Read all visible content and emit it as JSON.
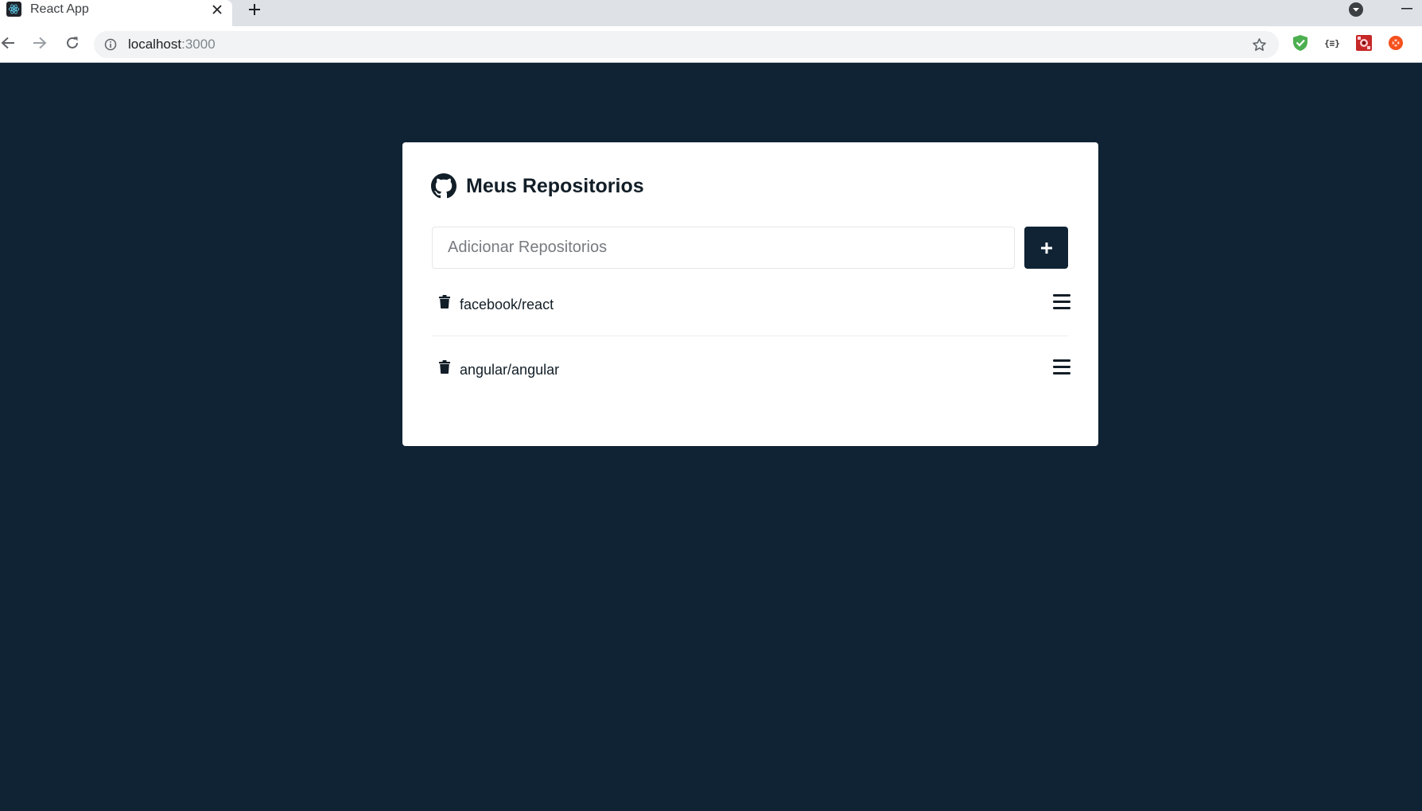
{
  "browser": {
    "tab_title": "React App",
    "url_host": "localhost",
    "url_port": ":3000",
    "icons": {
      "favicon": "react-logo-icon",
      "close": "close-icon",
      "new_tab": "plus-icon",
      "tab_menu": "chevron-down-icon",
      "minimize": "minimize-icon",
      "back": "arrow-left-icon",
      "forward": "arrow-right-icon",
      "reload": "reload-icon",
      "site_info": "info-icon",
      "bookmark": "star-icon"
    },
    "extensions": [
      {
        "name": "shield-extension-icon",
        "color": "#4caf50"
      },
      {
        "name": "json-extension-icon",
        "label": "{≡}"
      },
      {
        "name": "red-extension-icon",
        "color": "#c62828"
      },
      {
        "name": "orange-extension-icon",
        "color": "#f4511e"
      }
    ]
  },
  "page": {
    "title": "Meus Repositorios",
    "title_icon": "github-icon",
    "input": {
      "placeholder": "Adicionar Repositorios",
      "value": ""
    },
    "add_button_icon": "plus-icon",
    "repositories": [
      {
        "name": "facebook/react",
        "delete_icon": "trash-icon",
        "menu_icon": "bars-icon"
      },
      {
        "name": "angular/angular",
        "delete_icon": "trash-icon",
        "menu_icon": "bars-icon"
      }
    ]
  },
  "colors": {
    "background": "#0f2334",
    "card": "#ffffff",
    "button": "#0f2334",
    "text": "#121e27"
  }
}
